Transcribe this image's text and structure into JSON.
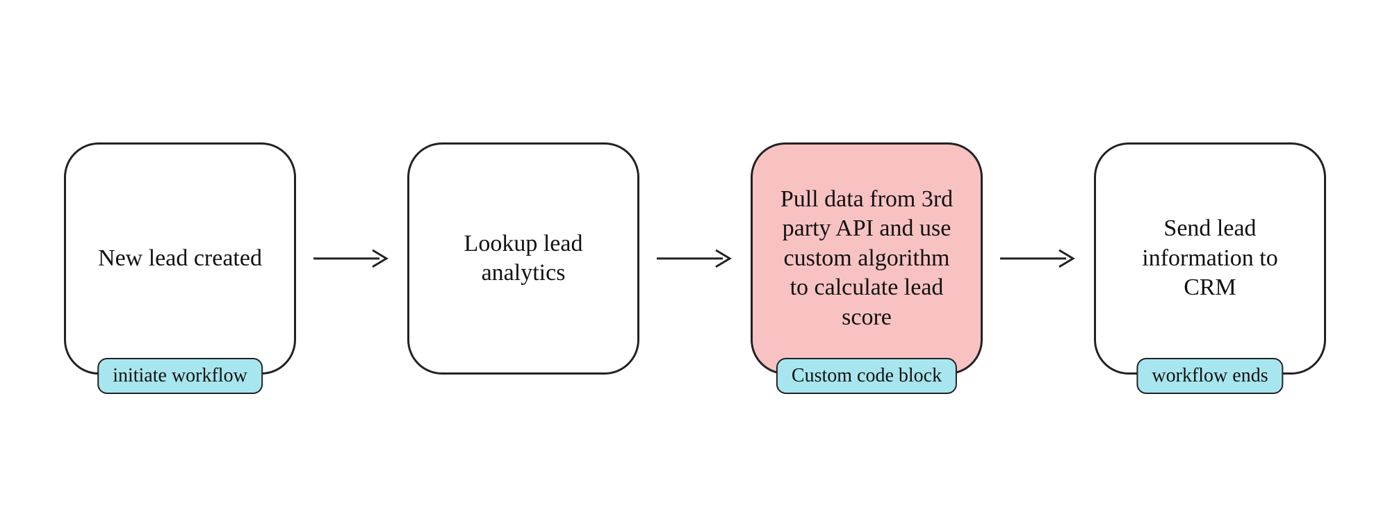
{
  "steps": [
    {
      "text": "New lead created",
      "badge": "initiate workflow",
      "highlight": false
    },
    {
      "text": "Lookup lead analytics",
      "badge": null,
      "highlight": false
    },
    {
      "text": "Pull data from 3rd party API and use custom algorithm to calculate lead score",
      "badge": "Custom code block",
      "highlight": true
    },
    {
      "text": "Send lead information to CRM",
      "badge": "workflow ends",
      "highlight": false
    }
  ]
}
